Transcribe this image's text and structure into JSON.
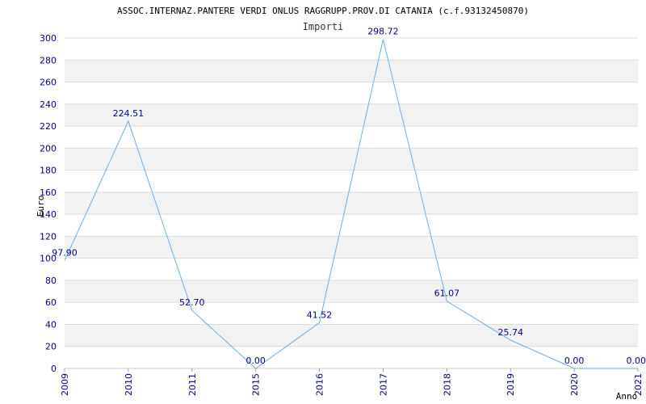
{
  "chart_data": {
    "type": "line",
    "title": "ASSOC.INTERNAZ.PANTERE VERDI ONLUS RAGGRUPP.PROV.DI CATANIA (c.f.93132450870)",
    "subtitle": "Importi",
    "xlabel": "Anno",
    "ylabel": "Euro",
    "categories": [
      "2009",
      "2010",
      "2011",
      "2015",
      "2016",
      "2017",
      "2018",
      "2019",
      "2020",
      "2021"
    ],
    "series": [
      {
        "values": [
          97.9,
          224.51,
          52.7,
          0.0,
          41.52,
          298.72,
          61.07,
          25.74,
          0.0,
          0.0
        ],
        "labels": [
          "97.90",
          "224.51",
          "52.70",
          "0.00",
          "41.52",
          "298.72",
          "61.07",
          "25.74",
          "0.00",
          "0.00"
        ]
      }
    ],
    "ylim": [
      0,
      300
    ],
    "yticks": [
      "0",
      "20",
      "40",
      "60",
      "80",
      "100",
      "120",
      "140",
      "160",
      "180",
      "200",
      "220",
      "240",
      "260",
      "280",
      "300"
    ],
    "grid": "horizontal alternating bands",
    "colors": {
      "line": "#6aaee8",
      "band": "#f2f2f2",
      "grid": "#dddddd",
      "tick_text": "#00008b"
    }
  }
}
